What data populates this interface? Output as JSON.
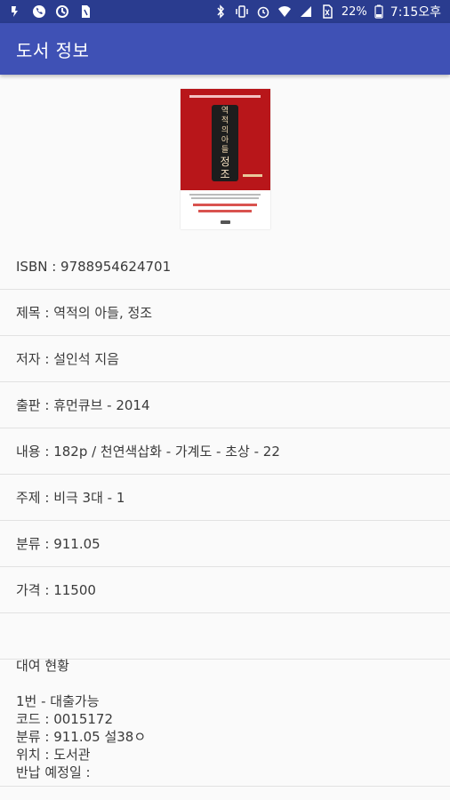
{
  "status_bar": {
    "battery": "22%",
    "time": "7:15오후"
  },
  "app_bar": {
    "title": "도서 정보"
  },
  "book": {
    "rows": [
      {
        "text": "ISBN : 9788954624701"
      },
      {
        "text": "제목 : 역적의 아들, 정조"
      },
      {
        "text": "저자 : 설인석 지음"
      },
      {
        "text": "출판 : 휴먼큐브 - 2014"
      },
      {
        "text": "내용 : 182p / 천연색삽화 - 가계도 - 초상 - 22"
      },
      {
        "text": "주제 : 비극 3대 - 1"
      },
      {
        "text": "분류 : 911.05"
      },
      {
        "text": "가격 : 11500"
      },
      {
        "text": ""
      }
    ]
  },
  "rental": {
    "heading": "대여 현황",
    "item_title": "1번 - 대출가능",
    "code": "코드 : 0015172",
    "classification": "분류 : 911.05 설38ㅇ",
    "location": "위치 : 도서관",
    "return_date": "반납 예정일 :"
  },
  "icons": {
    "status_left": [
      "nfc-icon",
      "phone-icon",
      "sync-icon",
      "sim-icon"
    ],
    "status_right": [
      "bluetooth-icon",
      "vibrate-icon",
      "alarm-icon",
      "wifi-icon",
      "signal-icon",
      "no-sim-icon",
      "battery-icon"
    ]
  },
  "colors": {
    "status_bar": "#2a3c8f",
    "app_bar": "#3f51b5",
    "cover_red": "#b8161a"
  }
}
